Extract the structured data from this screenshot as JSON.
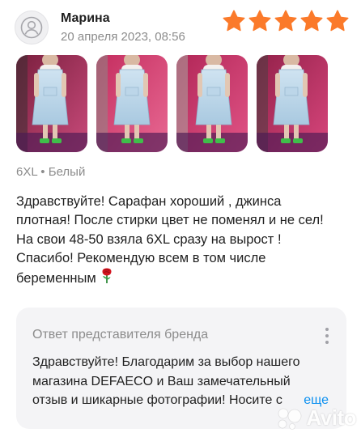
{
  "review": {
    "author": "Марина",
    "date": "20 апреля 2023, 08:56",
    "rating": 5,
    "rating_max": 5,
    "star_color": "#fb7a2a",
    "photos": [
      "photo-1",
      "photo-2",
      "photo-3",
      "photo-4"
    ],
    "variant": "6XL • Белый",
    "text_lines": [
      "Здравствуйте! Сарафан хороший  , джинса",
      "плотная! После стирки цвет не поменял  и не сел!",
      "На свои 48-50  взяла 6XL  сразу на вырост  !",
      "Спасибо! Рекомендую  всем  в  том числе",
      "беременным"
    ],
    "emoji": "rose"
  },
  "brand_reply": {
    "title": "Ответ представителя бренда",
    "text_lines": [
      "Здравствуйте! Благодарим за выбор нашего",
      "магазина DEFAECO и Ваш замечательный",
      "отзыв и шикарные фотографии! Носите с"
    ],
    "more_label": "еще",
    "link_color": "#0a8ff0"
  },
  "watermark": {
    "text": "Avito"
  }
}
